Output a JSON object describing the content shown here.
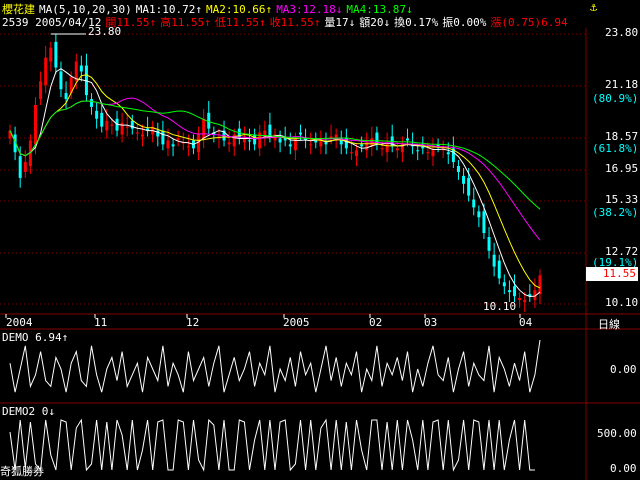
{
  "header": {
    "stock_name": "櫻花建",
    "ma_label": "MA(5,10,20,30)",
    "ma1": "MA1:10.72↑",
    "ma2": "MA2:10.66↑",
    "ma3": "MA3:12.18↓",
    "ma4": "MA4:13.87↓",
    "code_date": "2539 2005/04/12",
    "open": "開11.55↑",
    "high": "高11.55↑",
    "low": "低11.55↑",
    "close": "收11.55↑",
    "volume": "量17↓",
    "amount": "額20↓",
    "turnover": "換0.17%",
    "amplitude": "振0.00%",
    "change": "漲(0.75)6.94"
  },
  "price_axis": {
    "labels": [
      "23.80",
      "21.18",
      "(80.9%)",
      "18.57",
      "(61.8%)",
      "16.95",
      "15.33",
      "(38.2%)",
      "12.72",
      "(19.1%)",
      "10.10"
    ],
    "current_price": "11.55",
    "high_marker": "23.80",
    "low_marker": "10.10"
  },
  "time_axis": {
    "labels": [
      "2004",
      "11",
      "12",
      "2005",
      "02",
      "03",
      "04"
    ],
    "period_button": "日線"
  },
  "indicator1": {
    "title": "DEMO 6.94↑",
    "axis": "0.00"
  },
  "indicator2": {
    "title": "DEMO2 0↓",
    "axis_top": "500.00",
    "axis_bottom": "0.00"
  },
  "footer": {
    "logo": "奇狐勝券"
  },
  "colors": {
    "up": "#ff0000",
    "down": "#00ffff",
    "ma1": "#ffffff",
    "ma2": "#ffff00",
    "ma3": "#ff00ff",
    "ma4": "#00ff00",
    "grid": "#800000"
  },
  "chart_data": [
    {
      "type": "candlestick",
      "ylim": [
        10.1,
        23.8
      ],
      "closes": [
        18.9,
        17.8,
        16.5,
        17.3,
        18.4,
        20.2,
        21.4,
        22.6,
        23.1,
        22.1,
        21.0,
        20.5,
        21.6,
        22.4,
        21.9,
        20.7,
        20.1,
        19.5,
        19.1,
        19.4,
        19.2,
        18.9,
        19.3,
        19.1,
        19.0,
        18.8,
        18.7,
        18.9,
        19.1,
        18.6,
        18.2,
        18.4,
        18.1,
        18.5,
        18.3,
        18.1,
        18.0,
        18.7,
        19.5,
        19.0,
        18.7,
        18.6,
        18.4,
        18.3,
        18.7,
        18.5,
        18.6,
        18.4,
        18.2,
        18.8,
        18.9,
        18.6,
        18.7,
        18.3,
        18.4,
        18.1,
        18.5,
        18.7,
        18.4,
        18.2,
        18.3,
        18.5,
        18.2,
        18.6,
        18.7,
        18.2,
        18.0,
        17.8,
        17.9,
        18.1,
        18.3,
        18.5,
        18.2,
        18.0,
        18.3,
        18.1,
        18.0,
        18.2,
        18.4,
        18.1,
        17.9,
        18.0,
        17.8,
        17.9,
        18.1,
        18.0,
        17.7,
        17.3,
        16.8,
        16.2,
        15.6,
        15.0,
        14.5,
        13.7,
        12.8,
        12.0,
        11.4,
        11.0,
        10.7,
        10.5,
        10.4,
        10.3,
        10.5,
        10.8,
        11.55
      ],
      "ma1_label": "MA1",
      "ma2_label": "MA2",
      "ma3_label": "MA3",
      "ma4_label": "MA4"
    },
    {
      "type": "line",
      "name": "DEMO",
      "values": [
        0.6,
        0.1,
        0.5,
        0.9,
        0.2,
        0.4,
        0.8,
        0.3,
        0.2,
        0.7,
        0.5,
        0.1,
        0.6,
        0.8,
        0.3,
        0.2,
        0.9,
        0.4,
        0.1,
        0.5,
        0.7,
        0.3,
        0.8,
        0.2,
        0.4,
        0.6,
        0.1,
        0.7,
        0.5,
        0.3,
        0.9,
        0.2,
        0.6,
        0.4,
        0.1,
        0.8,
        0.3,
        0.5,
        0.7,
        0.2,
        0.6,
        0.9,
        0.1,
        0.4,
        0.7,
        0.3,
        0.5,
        0.8,
        0.2,
        0.6,
        0.4,
        0.9,
        0.1,
        0.5,
        0.3,
        0.7,
        0.2,
        0.8,
        0.4,
        0.6,
        0.1,
        0.5,
        0.9,
        0.3,
        0.7,
        0.2,
        0.6,
        0.4,
        0.8,
        0.1,
        0.5,
        0.3,
        0.9,
        0.2,
        0.6,
        0.4,
        0.7,
        0.3,
        0.8,
        0.1,
        0.5,
        0.2,
        0.6,
        0.9,
        0.4,
        0.3,
        0.7,
        0.1,
        0.5,
        0.8,
        0.2,
        0.6,
        0.4,
        0.3,
        0.9,
        0.1,
        0.7,
        0.5,
        0.2,
        0.6,
        0.3,
        0.8,
        0.1,
        0.4,
        1.0
      ]
    },
    {
      "type": "line",
      "name": "DEMO2",
      "ylim": [
        0,
        500
      ],
      "values": [
        380,
        0,
        500,
        20,
        480,
        60,
        0,
        500,
        150,
        0,
        500,
        480,
        0,
        420,
        500,
        0,
        60,
        500,
        0,
        480,
        0,
        500,
        350,
        0,
        500,
        0,
        200,
        500,
        0,
        480,
        500,
        0,
        0,
        500,
        480,
        0,
        500,
        100,
        0,
        500,
        450,
        0,
        500,
        0,
        0,
        500,
        480,
        0,
        300,
        500,
        0,
        500,
        0,
        480,
        500,
        0,
        60,
        500,
        0,
        500,
        0,
        420,
        500,
        0,
        500,
        0,
        480,
        0,
        500,
        200,
        0,
        500,
        500,
        0,
        480,
        0,
        500,
        0,
        500,
        300,
        0,
        500,
        0,
        480,
        500,
        0,
        500,
        0,
        100,
        500,
        0,
        500,
        480,
        0,
        500,
        0,
        500,
        0,
        300,
        500,
        0,
        500,
        0,
        0
      ]
    }
  ]
}
